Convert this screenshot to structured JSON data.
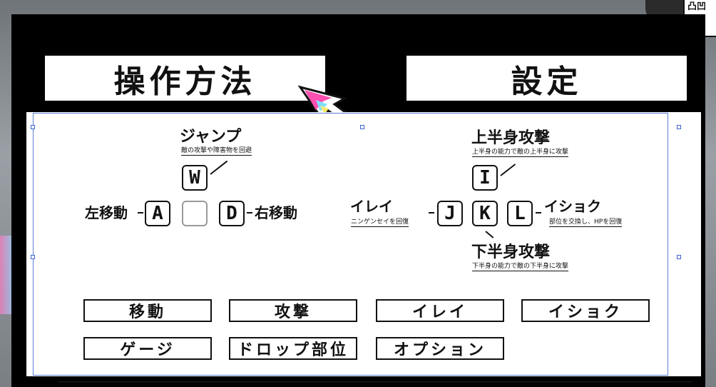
{
  "corner_badge": {
    "text": "凸凹\n◢▣"
  },
  "tabs": {
    "controls": "操作方法",
    "settings": "設定"
  },
  "controls": {
    "left_keys": {
      "jump_title": "ジャンプ",
      "jump_sub": "敵の攻撃や障害物を回避",
      "key_up": "W",
      "key_left": "A",
      "key_center": "",
      "key_right": "D",
      "move_left": "左移動",
      "move_right": "右移動"
    },
    "right_keys": {
      "upper_title": "上半身攻撃",
      "upper_sub": "上半身の能力で敵の上半身に攻撃",
      "key_up": "I",
      "key_left": "J",
      "key_center": "K",
      "key_right": "L",
      "irei_title": "イレイ",
      "irei_sub": "ニンゲンセイを回復",
      "ishoku_title": "イショク",
      "ishoku_sub": "部位を交換し、HPを回復",
      "lower_title": "下半身攻撃",
      "lower_sub": "下半身の能力で敵の下半身に攻撃"
    }
  },
  "menu": [
    {
      "label": "移動"
    },
    {
      "label": "攻撃"
    },
    {
      "label": "イレイ"
    },
    {
      "label": "イショク"
    },
    {
      "label": "ゲージ"
    },
    {
      "label": "ドロップ部位"
    },
    {
      "label": "オプション"
    }
  ],
  "colors": {
    "selection_frame": "#5b7fd6",
    "cursor_accent": "#ff4fb0"
  }
}
